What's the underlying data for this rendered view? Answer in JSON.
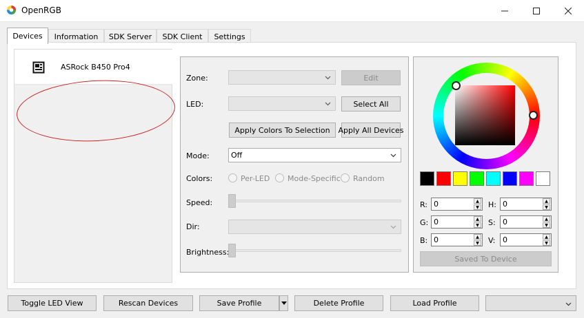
{
  "window": {
    "title": "OpenRGB"
  },
  "tabs": [
    {
      "label": "Devices",
      "active": true
    },
    {
      "label": "Information"
    },
    {
      "label": "SDK Server"
    },
    {
      "label": "SDK Client"
    },
    {
      "label": "Settings"
    }
  ],
  "devices": [
    {
      "name": "ASRock B450 Pro4",
      "icon": "motherboard-icon"
    }
  ],
  "controls": {
    "zone_label": "Zone:",
    "zone_value": "",
    "edit_label": "Edit",
    "led_label": "LED:",
    "led_value": "",
    "select_all_label": "Select All",
    "apply_selection_label": "Apply Colors To Selection",
    "apply_all_label": "Apply All Devices",
    "mode_label": "Mode:",
    "mode_value": "Off",
    "colors_label": "Colors:",
    "color_modes": [
      "Per-LED",
      "Mode-Specific",
      "Random"
    ],
    "speed_label": "Speed:",
    "dir_label": "Dir:",
    "brightness_label": "Brightness:"
  },
  "color_picker": {
    "swatches": [
      "#000000",
      "#ff0000",
      "#ffff00",
      "#00ff00",
      "#00ffff",
      "#0000ff",
      "#ff00ff",
      "#ffffff"
    ],
    "r_label": "R:",
    "r": "0",
    "g_label": "G:",
    "g": "0",
    "b_label": "B:",
    "b": "0",
    "h_label": "H:",
    "h": "0",
    "s_label": "S:",
    "s": "0",
    "v_label": "V:",
    "v": "0",
    "saved_label": "Saved To Device"
  },
  "bottom": {
    "toggle_led_view": "Toggle LED View",
    "rescan_devices": "Rescan Devices",
    "save_profile": "Save Profile",
    "delete_profile": "Delete Profile",
    "load_profile": "Load Profile",
    "profile_select_value": ""
  }
}
